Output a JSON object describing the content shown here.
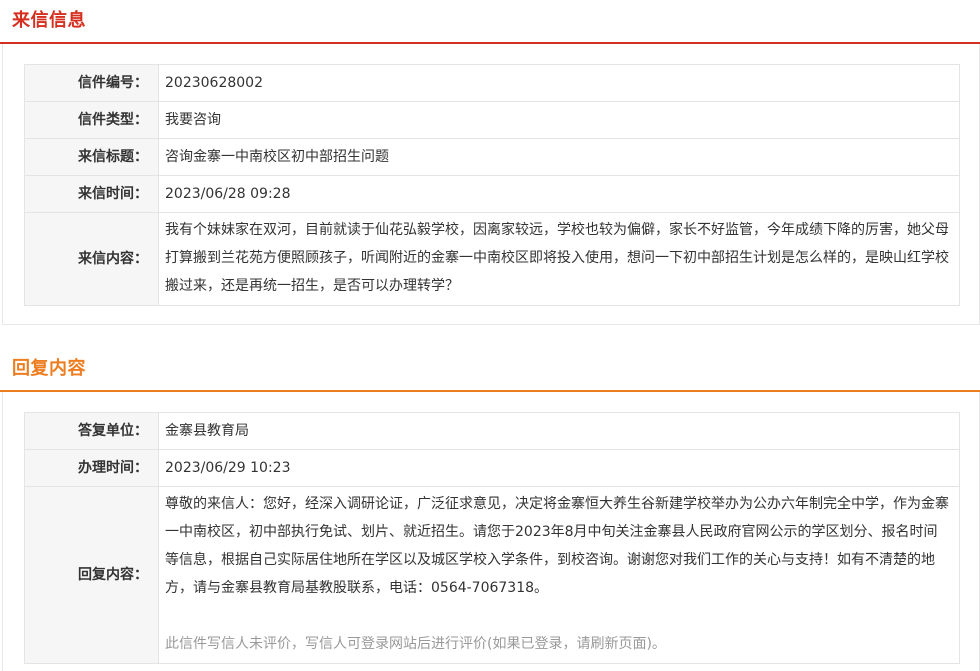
{
  "letter_section": {
    "title": "来信信息",
    "rows": [
      {
        "label": "信件编号：",
        "value": "20230628002"
      },
      {
        "label": "信件类型：",
        "value": "我要咨询"
      },
      {
        "label": "来信标题：",
        "value": "咨询金寨一中南校区初中部招生问题"
      },
      {
        "label": "来信时间：",
        "value": "2023/06/28 09:28"
      },
      {
        "label": "来信内容：",
        "value": "我有个妹妹家在双河，目前就读于仙花弘毅学校，因离家较远，学校也较为偏僻，家长不好监管，今年成绩下降的厉害，她父母打算搬到兰花苑方便照顾孩子，听闻附近的金寨一中南校区即将投入使用，想问一下初中部招生计划是怎么样的，是映山红学校搬过来，还是再统一招生，是否可以办理转学？"
      }
    ]
  },
  "reply_section": {
    "title": "回复内容",
    "rows": [
      {
        "label": "答复单位：",
        "value": "金寨县教育局"
      },
      {
        "label": "办理时间：",
        "value": "2023/06/29 10:23"
      },
      {
        "label": "回复内容：",
        "value": "尊敬的来信人：您好，经深入调研论证，广泛征求意见，决定将金寨恒大养生谷新建学校举办为公办六年制完全中学，作为金寨一中南校区，初中部执行免试、划片、就近招生。请您于2023年8月中旬关注金寨县人民政府官网公示的学区划分、报名时间等信息，根据自己实际居住地所在学区以及城区学校入学条件，到校咨询。谢谢您对我们工作的关心与支持！如有不清楚的地方，请与金寨县教育局基教股联系，电话：0564-7067318。"
      }
    ],
    "evaluation_note": "此信件写信人未评价，写信人可登录网站后进行评价(如果已登录，请刷新页面)。"
  },
  "colors": {
    "letter_accent": "#d62f1f",
    "reply_accent": "#ee7d20",
    "label_background": "#f6f6f6",
    "note_text": "#999999"
  }
}
